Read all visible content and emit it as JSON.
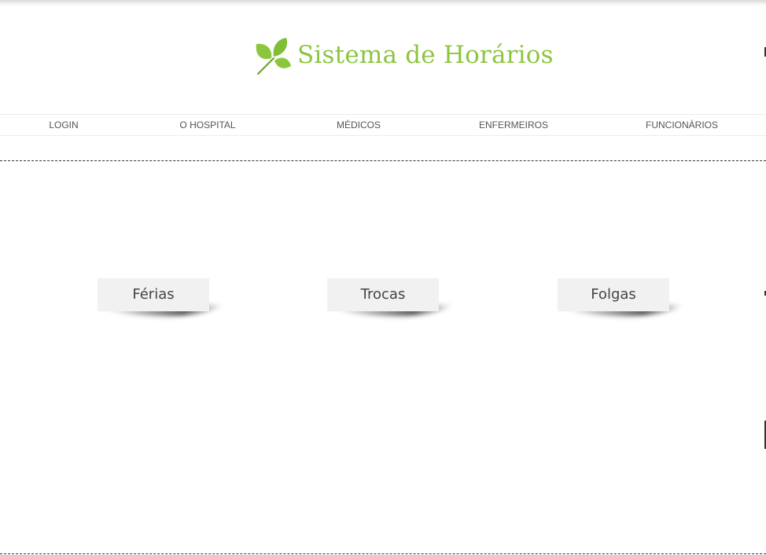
{
  "header": {
    "title": "Sistema de Horários",
    "logo_icon": "leaf-icon",
    "brand_color": "#8cc63f"
  },
  "nav": {
    "items": [
      {
        "label": "LOGIN"
      },
      {
        "label": "O HOSPITAL"
      },
      {
        "label": "MÉDICOS"
      },
      {
        "label": "ENFERMEIROS"
      },
      {
        "label": "FUNCIONÁRIOS"
      }
    ]
  },
  "main": {
    "cards": [
      {
        "label": "Férias"
      },
      {
        "label": "Trocas"
      },
      {
        "label": "Folgas"
      }
    ]
  }
}
